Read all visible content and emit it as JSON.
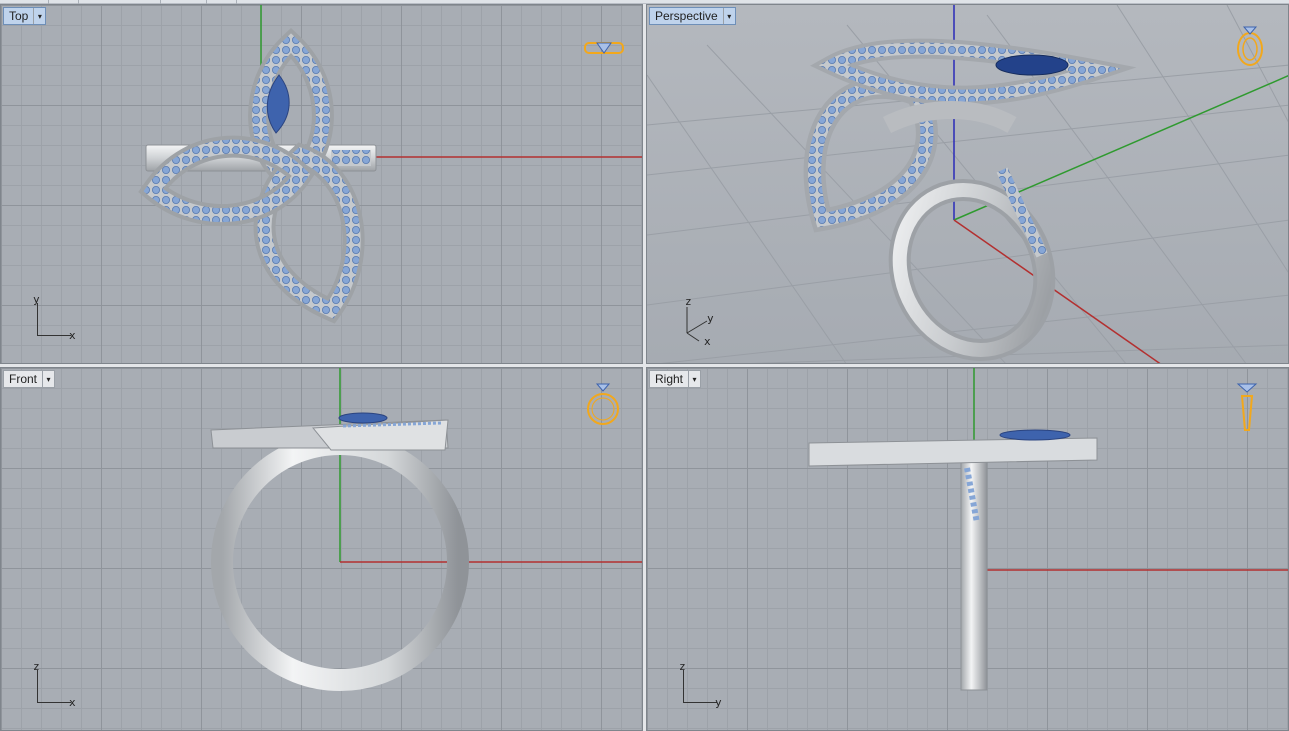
{
  "viewports": {
    "top": {
      "label": "Top",
      "axis1": "y",
      "axis2": "x"
    },
    "perspective": {
      "label": "Perspective",
      "axis_z": "z",
      "axis_y": "y",
      "axis_x": "x"
    },
    "front": {
      "label": "Front",
      "axis1": "z",
      "axis2": "x"
    },
    "right": {
      "label": "Right",
      "axis1": "z",
      "axis2": "y"
    }
  },
  "dropdown_glyph": "▾",
  "colors": {
    "grid_bg": "#a8adb4",
    "world_x_axis": "#b33030",
    "world_y_axis": "#2f9a2f",
    "world_z_axis": "#2a2ab8",
    "metal": "#d7d9db",
    "gem_small": "#7f9fd0",
    "gem_center": "#3a5aa6",
    "thumbnail": "#f2a81c"
  },
  "icons": [
    "dropdown-arrow-icon",
    "ring-thumbnail-icon",
    "axis-indicator-icon"
  ]
}
